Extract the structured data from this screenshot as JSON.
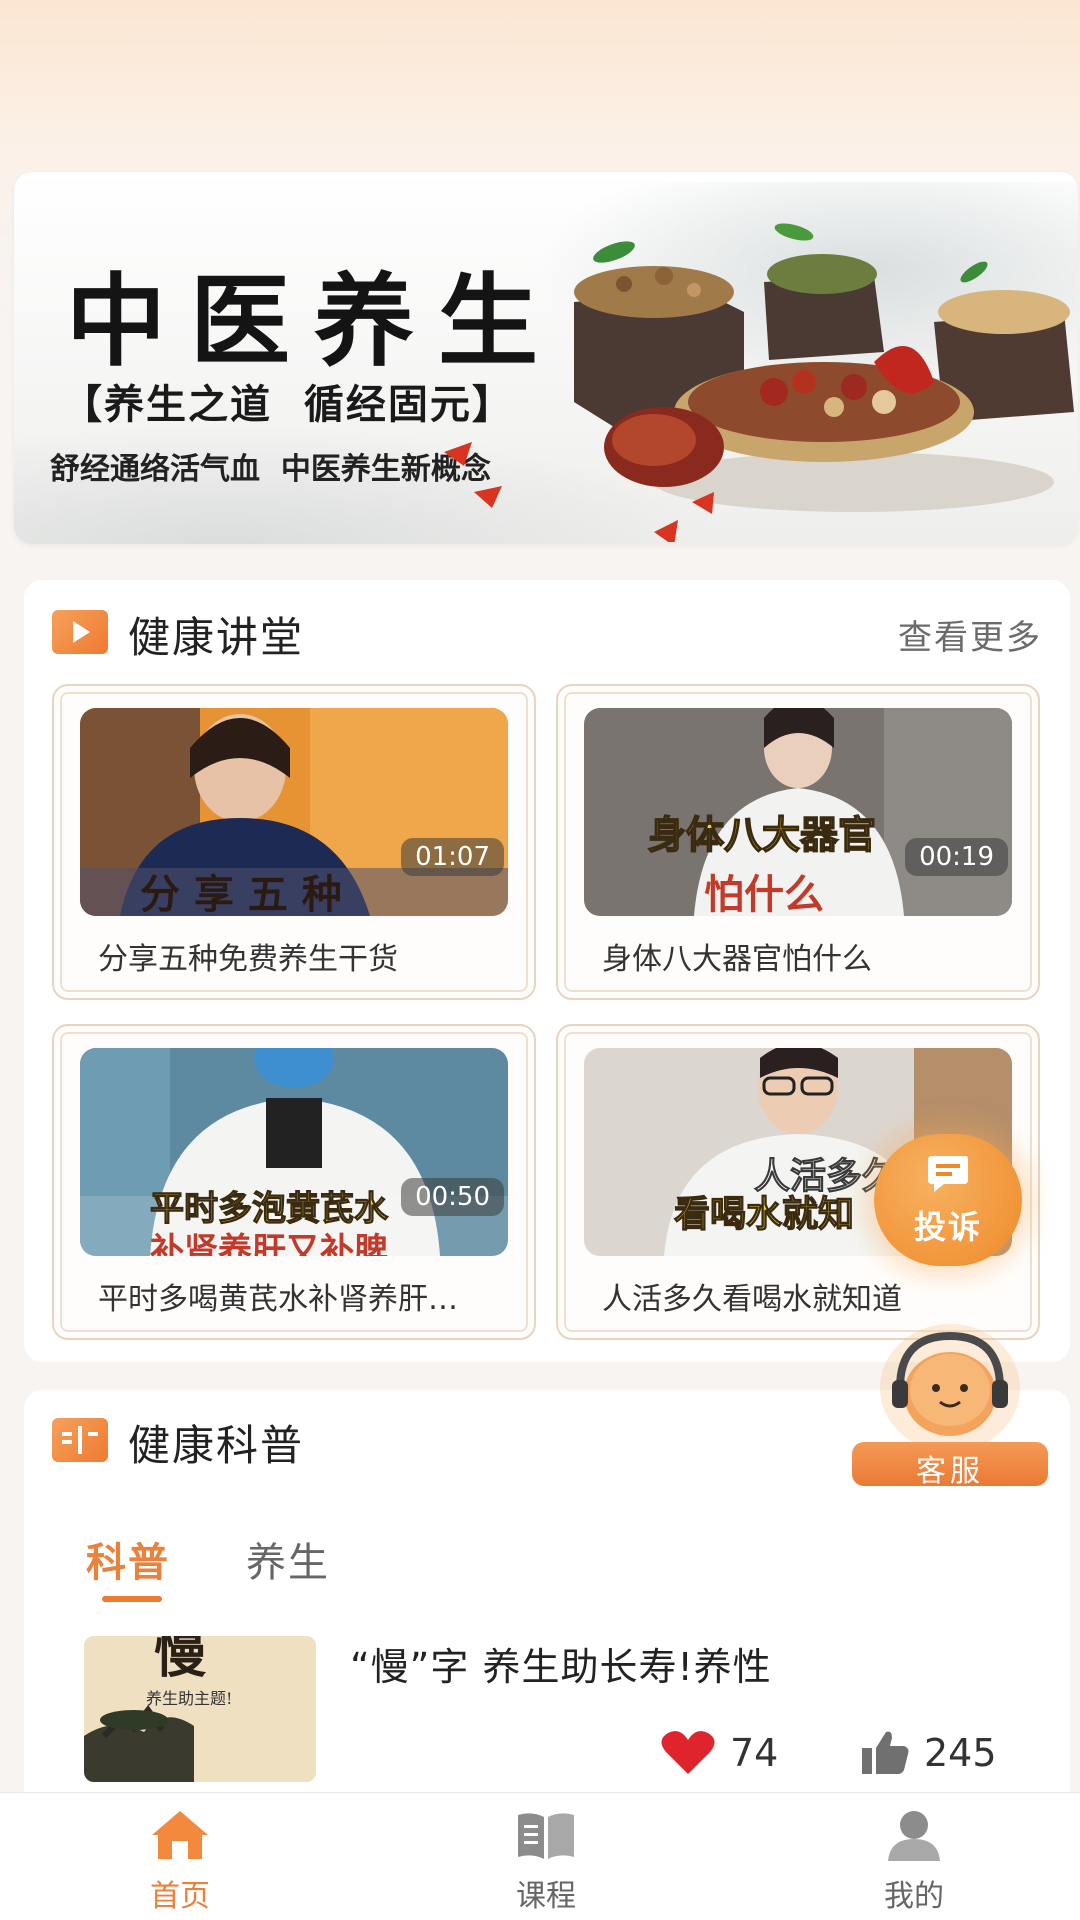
{
  "banner": {
    "title": "中医养生",
    "subtitle": "【养生之道  循经固元】",
    "tagline": "舒经通络活气血  中医养生新概念"
  },
  "lecture": {
    "title": "健康讲堂",
    "more": "查看更多",
    "videos": [
      {
        "title": "分享五种免费养生干货",
        "duration": "01:07",
        "caption": "分 享 五 种"
      },
      {
        "title": "身体八大器官怕什么",
        "duration": "00:19",
        "caption": "身体八大器官",
        "caption2": "怕什么"
      },
      {
        "title": "平时多喝黄芪水补肾养肝…",
        "duration": "00:50",
        "caption": "平时多泡黄芪水",
        "caption2": "补肾养肝又补脾"
      },
      {
        "title": "人活多久看喝水就知道",
        "duration": "",
        "caption": "人活多久",
        "caption2": "看喝水就知"
      }
    ]
  },
  "science": {
    "title": "健康科普",
    "tabs": [
      {
        "label": "科普",
        "active": true
      },
      {
        "label": "养生",
        "active": false
      }
    ],
    "article": {
      "title": "“慢”字 养生助长寿!养性",
      "thumb_char": "慢",
      "thumb_text": "养生助主题!",
      "likes": "74",
      "thumbs_up": "245"
    }
  },
  "floating": {
    "complaint": "投诉",
    "service": "客服"
  },
  "nav": {
    "items": [
      {
        "label": "首页",
        "icon": "home-icon",
        "active": true
      },
      {
        "label": "课程",
        "icon": "book-icon",
        "active": false
      },
      {
        "label": "我的",
        "icon": "user-icon",
        "active": false
      }
    ]
  },
  "colors": {
    "accent": "#ee7a33",
    "active_text": "#e8823d",
    "like_red": "#e0242d"
  }
}
